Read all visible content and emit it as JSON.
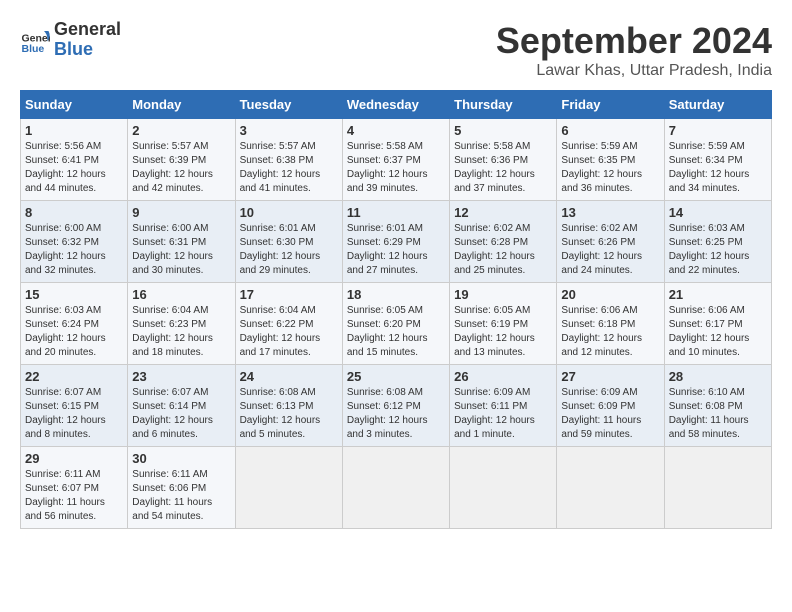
{
  "logo": {
    "line1": "General",
    "line2": "Blue"
  },
  "title": "September 2024",
  "subtitle": "Lawar Khas, Uttar Pradesh, India",
  "weekdays": [
    "Sunday",
    "Monday",
    "Tuesday",
    "Wednesday",
    "Thursday",
    "Friday",
    "Saturday"
  ],
  "weeks": [
    [
      {
        "day": "1",
        "sunrise": "Sunrise: 5:56 AM",
        "sunset": "Sunset: 6:41 PM",
        "daylight": "Daylight: 12 hours and 44 minutes."
      },
      {
        "day": "2",
        "sunrise": "Sunrise: 5:57 AM",
        "sunset": "Sunset: 6:39 PM",
        "daylight": "Daylight: 12 hours and 42 minutes."
      },
      {
        "day": "3",
        "sunrise": "Sunrise: 5:57 AM",
        "sunset": "Sunset: 6:38 PM",
        "daylight": "Daylight: 12 hours and 41 minutes."
      },
      {
        "day": "4",
        "sunrise": "Sunrise: 5:58 AM",
        "sunset": "Sunset: 6:37 PM",
        "daylight": "Daylight: 12 hours and 39 minutes."
      },
      {
        "day": "5",
        "sunrise": "Sunrise: 5:58 AM",
        "sunset": "Sunset: 6:36 PM",
        "daylight": "Daylight: 12 hours and 37 minutes."
      },
      {
        "day": "6",
        "sunrise": "Sunrise: 5:59 AM",
        "sunset": "Sunset: 6:35 PM",
        "daylight": "Daylight: 12 hours and 36 minutes."
      },
      {
        "day": "7",
        "sunrise": "Sunrise: 5:59 AM",
        "sunset": "Sunset: 6:34 PM",
        "daylight": "Daylight: 12 hours and 34 minutes."
      }
    ],
    [
      {
        "day": "8",
        "sunrise": "Sunrise: 6:00 AM",
        "sunset": "Sunset: 6:32 PM",
        "daylight": "Daylight: 12 hours and 32 minutes."
      },
      {
        "day": "9",
        "sunrise": "Sunrise: 6:00 AM",
        "sunset": "Sunset: 6:31 PM",
        "daylight": "Daylight: 12 hours and 30 minutes."
      },
      {
        "day": "10",
        "sunrise": "Sunrise: 6:01 AM",
        "sunset": "Sunset: 6:30 PM",
        "daylight": "Daylight: 12 hours and 29 minutes."
      },
      {
        "day": "11",
        "sunrise": "Sunrise: 6:01 AM",
        "sunset": "Sunset: 6:29 PM",
        "daylight": "Daylight: 12 hours and 27 minutes."
      },
      {
        "day": "12",
        "sunrise": "Sunrise: 6:02 AM",
        "sunset": "Sunset: 6:28 PM",
        "daylight": "Daylight: 12 hours and 25 minutes."
      },
      {
        "day": "13",
        "sunrise": "Sunrise: 6:02 AM",
        "sunset": "Sunset: 6:26 PM",
        "daylight": "Daylight: 12 hours and 24 minutes."
      },
      {
        "day": "14",
        "sunrise": "Sunrise: 6:03 AM",
        "sunset": "Sunset: 6:25 PM",
        "daylight": "Daylight: 12 hours and 22 minutes."
      }
    ],
    [
      {
        "day": "15",
        "sunrise": "Sunrise: 6:03 AM",
        "sunset": "Sunset: 6:24 PM",
        "daylight": "Daylight: 12 hours and 20 minutes."
      },
      {
        "day": "16",
        "sunrise": "Sunrise: 6:04 AM",
        "sunset": "Sunset: 6:23 PM",
        "daylight": "Daylight: 12 hours and 18 minutes."
      },
      {
        "day": "17",
        "sunrise": "Sunrise: 6:04 AM",
        "sunset": "Sunset: 6:22 PM",
        "daylight": "Daylight: 12 hours and 17 minutes."
      },
      {
        "day": "18",
        "sunrise": "Sunrise: 6:05 AM",
        "sunset": "Sunset: 6:20 PM",
        "daylight": "Daylight: 12 hours and 15 minutes."
      },
      {
        "day": "19",
        "sunrise": "Sunrise: 6:05 AM",
        "sunset": "Sunset: 6:19 PM",
        "daylight": "Daylight: 12 hours and 13 minutes."
      },
      {
        "day": "20",
        "sunrise": "Sunrise: 6:06 AM",
        "sunset": "Sunset: 6:18 PM",
        "daylight": "Daylight: 12 hours and 12 minutes."
      },
      {
        "day": "21",
        "sunrise": "Sunrise: 6:06 AM",
        "sunset": "Sunset: 6:17 PM",
        "daylight": "Daylight: 12 hours and 10 minutes."
      }
    ],
    [
      {
        "day": "22",
        "sunrise": "Sunrise: 6:07 AM",
        "sunset": "Sunset: 6:15 PM",
        "daylight": "Daylight: 12 hours and 8 minutes."
      },
      {
        "day": "23",
        "sunrise": "Sunrise: 6:07 AM",
        "sunset": "Sunset: 6:14 PM",
        "daylight": "Daylight: 12 hours and 6 minutes."
      },
      {
        "day": "24",
        "sunrise": "Sunrise: 6:08 AM",
        "sunset": "Sunset: 6:13 PM",
        "daylight": "Daylight: 12 hours and 5 minutes."
      },
      {
        "day": "25",
        "sunrise": "Sunrise: 6:08 AM",
        "sunset": "Sunset: 6:12 PM",
        "daylight": "Daylight: 12 hours and 3 minutes."
      },
      {
        "day": "26",
        "sunrise": "Sunrise: 6:09 AM",
        "sunset": "Sunset: 6:11 PM",
        "daylight": "Daylight: 12 hours and 1 minute."
      },
      {
        "day": "27",
        "sunrise": "Sunrise: 6:09 AM",
        "sunset": "Sunset: 6:09 PM",
        "daylight": "Daylight: 11 hours and 59 minutes."
      },
      {
        "day": "28",
        "sunrise": "Sunrise: 6:10 AM",
        "sunset": "Sunset: 6:08 PM",
        "daylight": "Daylight: 11 hours and 58 minutes."
      }
    ],
    [
      {
        "day": "29",
        "sunrise": "Sunrise: 6:11 AM",
        "sunset": "Sunset: 6:07 PM",
        "daylight": "Daylight: 11 hours and 56 minutes."
      },
      {
        "day": "30",
        "sunrise": "Sunrise: 6:11 AM",
        "sunset": "Sunset: 6:06 PM",
        "daylight": "Daylight: 11 hours and 54 minutes."
      },
      null,
      null,
      null,
      null,
      null
    ]
  ]
}
